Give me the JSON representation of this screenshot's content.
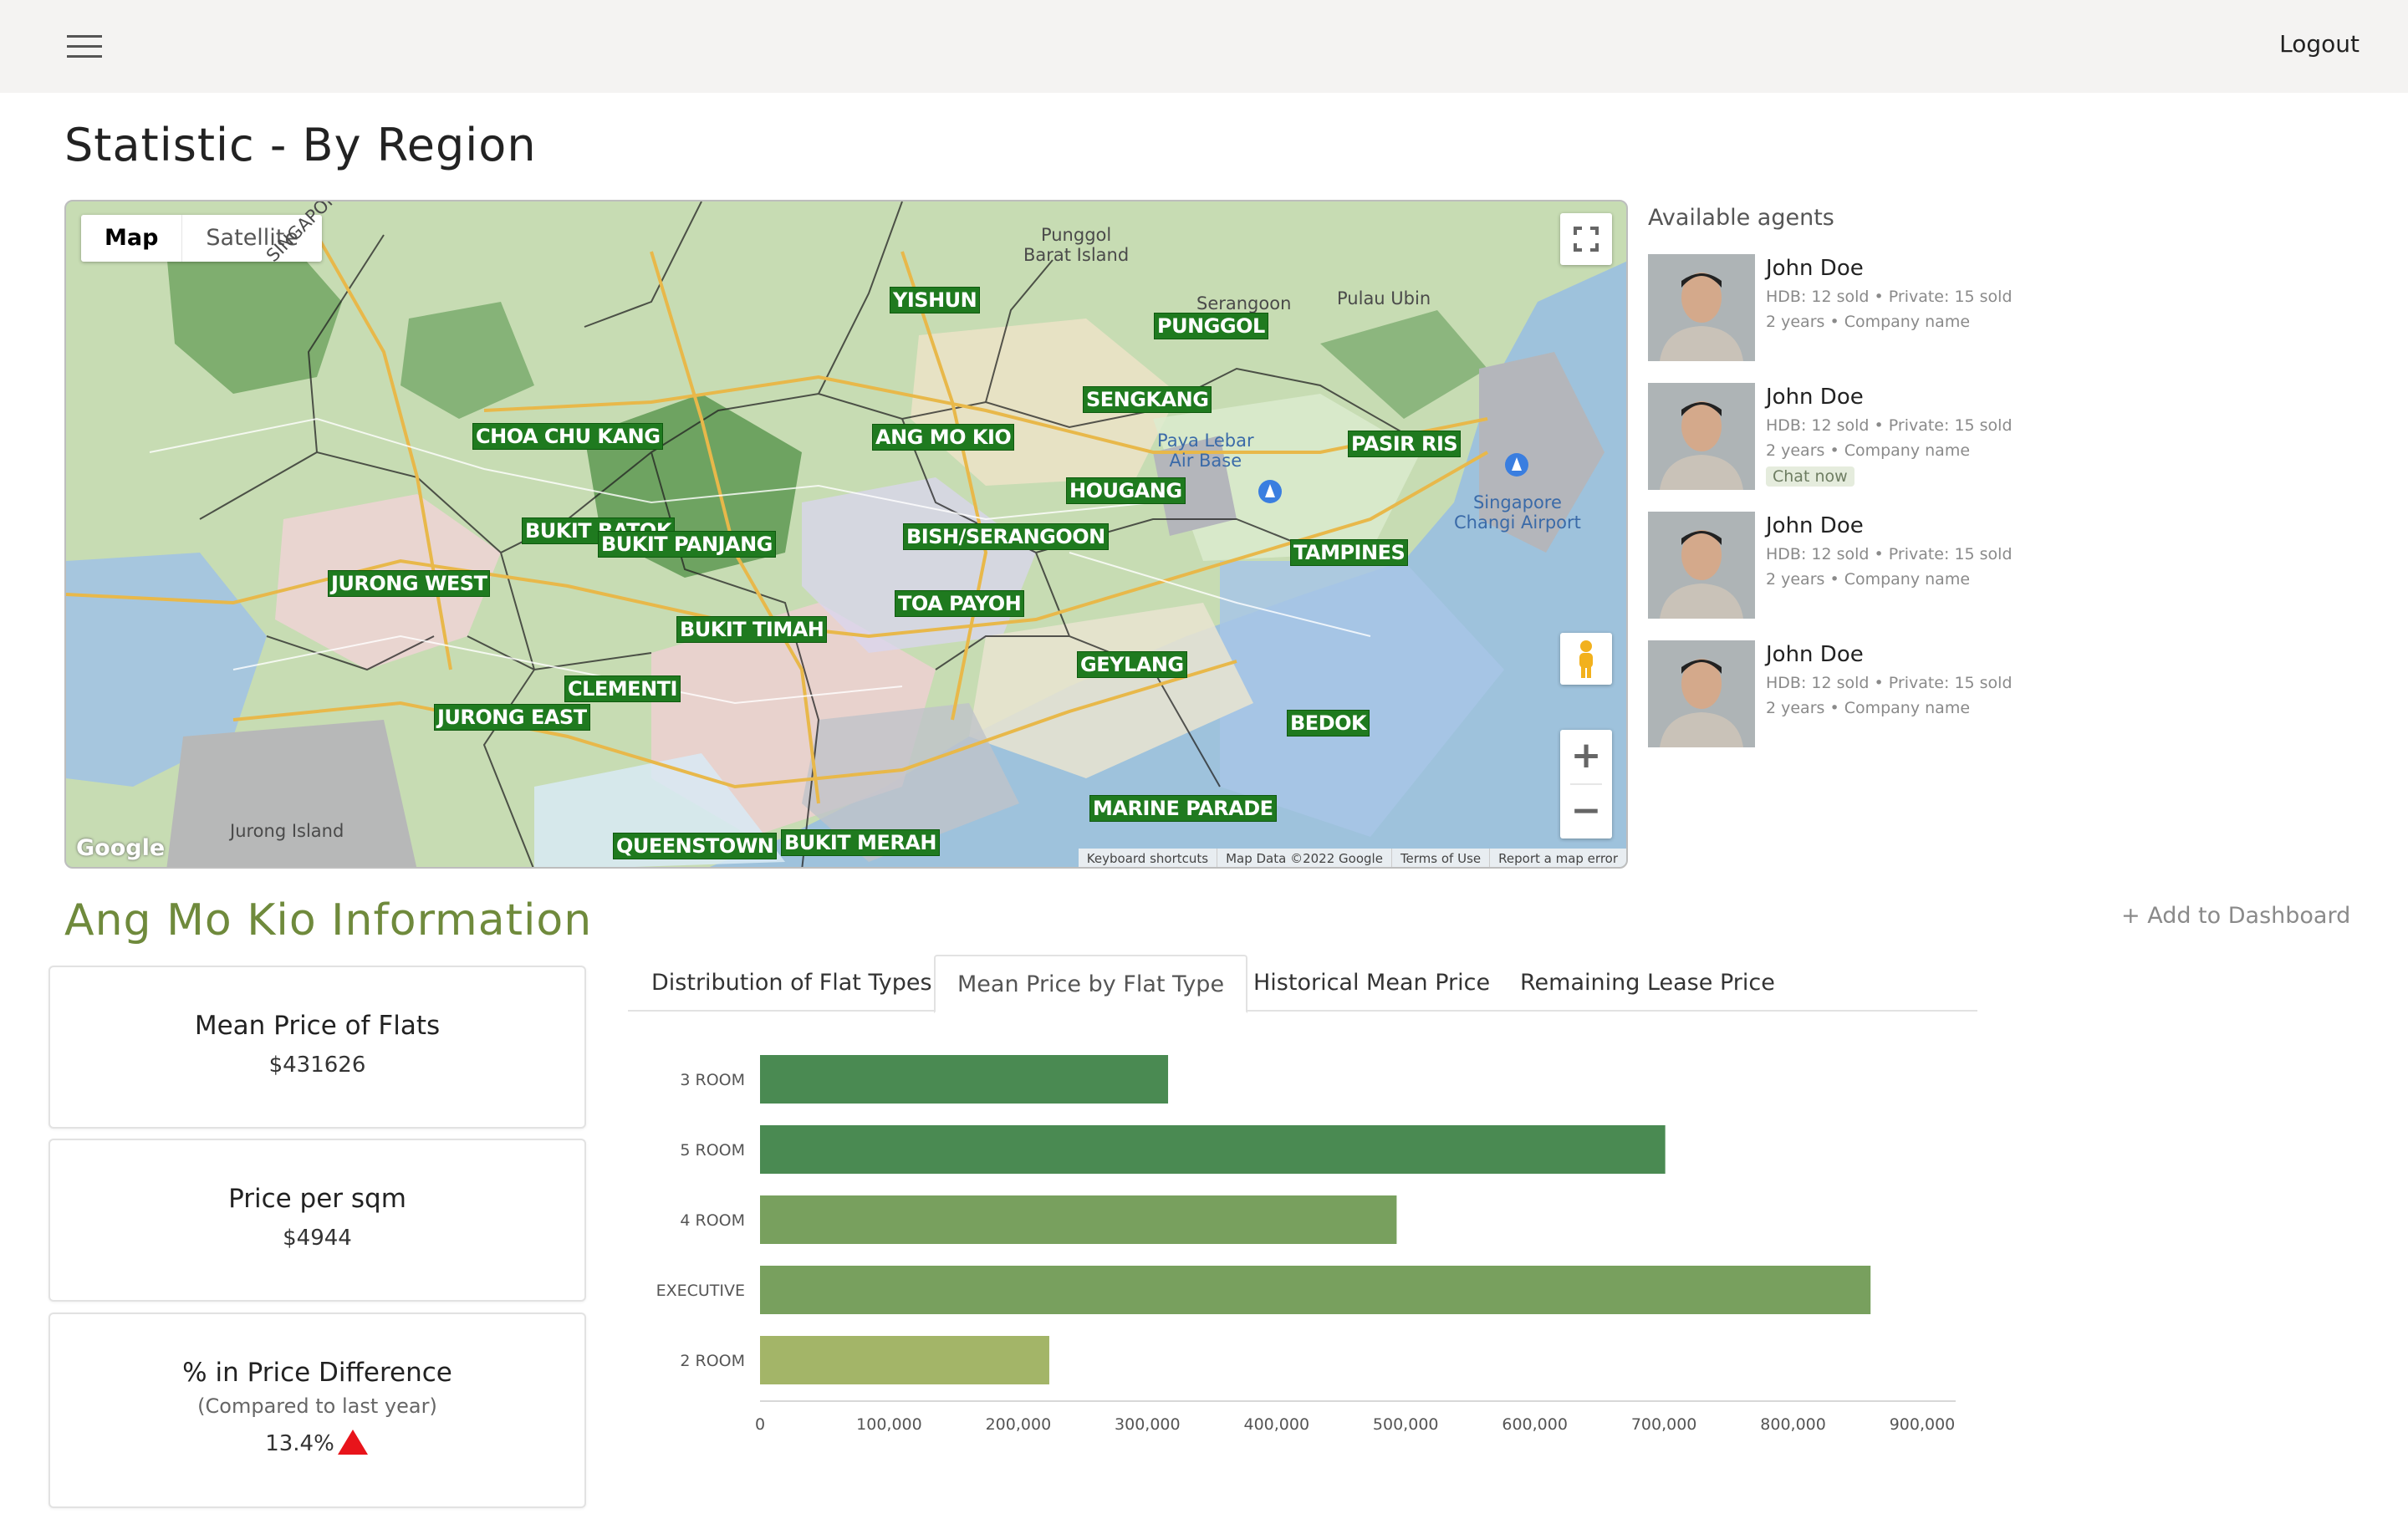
{
  "header": {
    "menu_icon": "hamburger-menu-icon",
    "logout_label": "Logout"
  },
  "page": {
    "title": "Statistic - By Region"
  },
  "map": {
    "type_map_label": "Map",
    "type_satellite_label": "Satellite",
    "google_label": "Google",
    "attribution": {
      "shortcuts": "Keyboard shortcuts",
      "data": "Map Data ©2022 Google",
      "terms": "Terms of Use",
      "report": "Report a map error"
    },
    "regions": {
      "choa_chu_kang": "CHOA CHU KANG",
      "yishun": "YISHUN",
      "punggol": "PUNGGOL",
      "sengkang": "SENGKANG",
      "ang_mo_kio": "ANG MO KIO",
      "pasir_ris": "PASIR RIS",
      "hougang": "HOUGANG",
      "bukit_batok": "BUKIT BATOK",
      "bukit_panjang": "BUKIT PANJANG",
      "bishan": "BISH/SERANGOON",
      "jurong_west": "JURONG WEST",
      "toa_payoh": "TOA PAYOH",
      "tampines": "TAMPINES",
      "bukit_timah": "BUKIT TIMAH",
      "geylang": "GEYLANG",
      "clementi": "CLEMENTI",
      "jurong_east": "JURONG EAST",
      "bedok": "BEDOK",
      "marine_parade": "MARINE PARADE",
      "queenstown": "QUEENSTOWN",
      "bukit_merah": "BUKIT MERAH"
    },
    "places": {
      "punggol_barat": "Punggol\nBarat Island",
      "serangoon": "Serangoon",
      "pulau_ubin": "Pulau Ubin",
      "paya_lebar": "Paya Lebar\nAir Base",
      "changi": "Singapore\nChangi Airport",
      "jurong_island": "Jurong Island",
      "singapore": "SINGAPORE"
    }
  },
  "agents": {
    "title": "Available agents",
    "list": [
      {
        "name": "John Doe",
        "stats": "HDB: 12 sold • Private: 15 sold",
        "meta": "2 years • Company name"
      },
      {
        "name": "John Doe",
        "stats": "HDB: 12 sold • Private: 15 sold",
        "meta": "2 years • Company name",
        "chat": "Chat now"
      },
      {
        "name": "John Doe",
        "stats": "HDB: 12 sold • Private: 15 sold",
        "meta": "2 years • Company name"
      },
      {
        "name": "John Doe",
        "stats": "HDB: 12 sold • Private: 15 sold",
        "meta": "2 years • Company name"
      }
    ]
  },
  "info": {
    "title": "Ang Mo Kio Information",
    "add_dashboard": "+ Add to Dashboard",
    "cards": {
      "mean_price": {
        "title": "Mean Price of Flats",
        "value": "$431626"
      },
      "price_sqm": {
        "title": "Price per sqm",
        "value": "$4944"
      },
      "price_diff": {
        "title": "% in Price Difference",
        "subtitle": "(Compared to last year)",
        "value": "13.4%",
        "trend": "up",
        "trend_color": "#e8141b"
      }
    },
    "tabs": [
      "Distribution of Flat Types",
      "Mean Price by Flat Type",
      "Historical Mean Price",
      "Remaining Lease Price"
    ],
    "active_tab": 1
  },
  "chart_data": {
    "type": "bar",
    "orientation": "horizontal",
    "title": "",
    "xlabel": "",
    "ylabel": "",
    "categories": [
      "3 ROOM",
      "5 ROOM",
      "4 ROOM",
      "EXECUTIVE",
      "2 ROOM"
    ],
    "values": [
      316000,
      701000,
      493000,
      860000,
      224000
    ],
    "colors": [
      "#4a8a52",
      "#4a8a52",
      "#78a05e",
      "#78a05e",
      "#a3b568"
    ],
    "xlim": [
      0,
      900000
    ],
    "xticks": [
      "0",
      "100,000",
      "200,000",
      "300,000",
      "400,000",
      "500,000",
      "600,000",
      "700,000",
      "800,000",
      "900,000"
    ],
    "grid": false,
    "legend": "none"
  }
}
